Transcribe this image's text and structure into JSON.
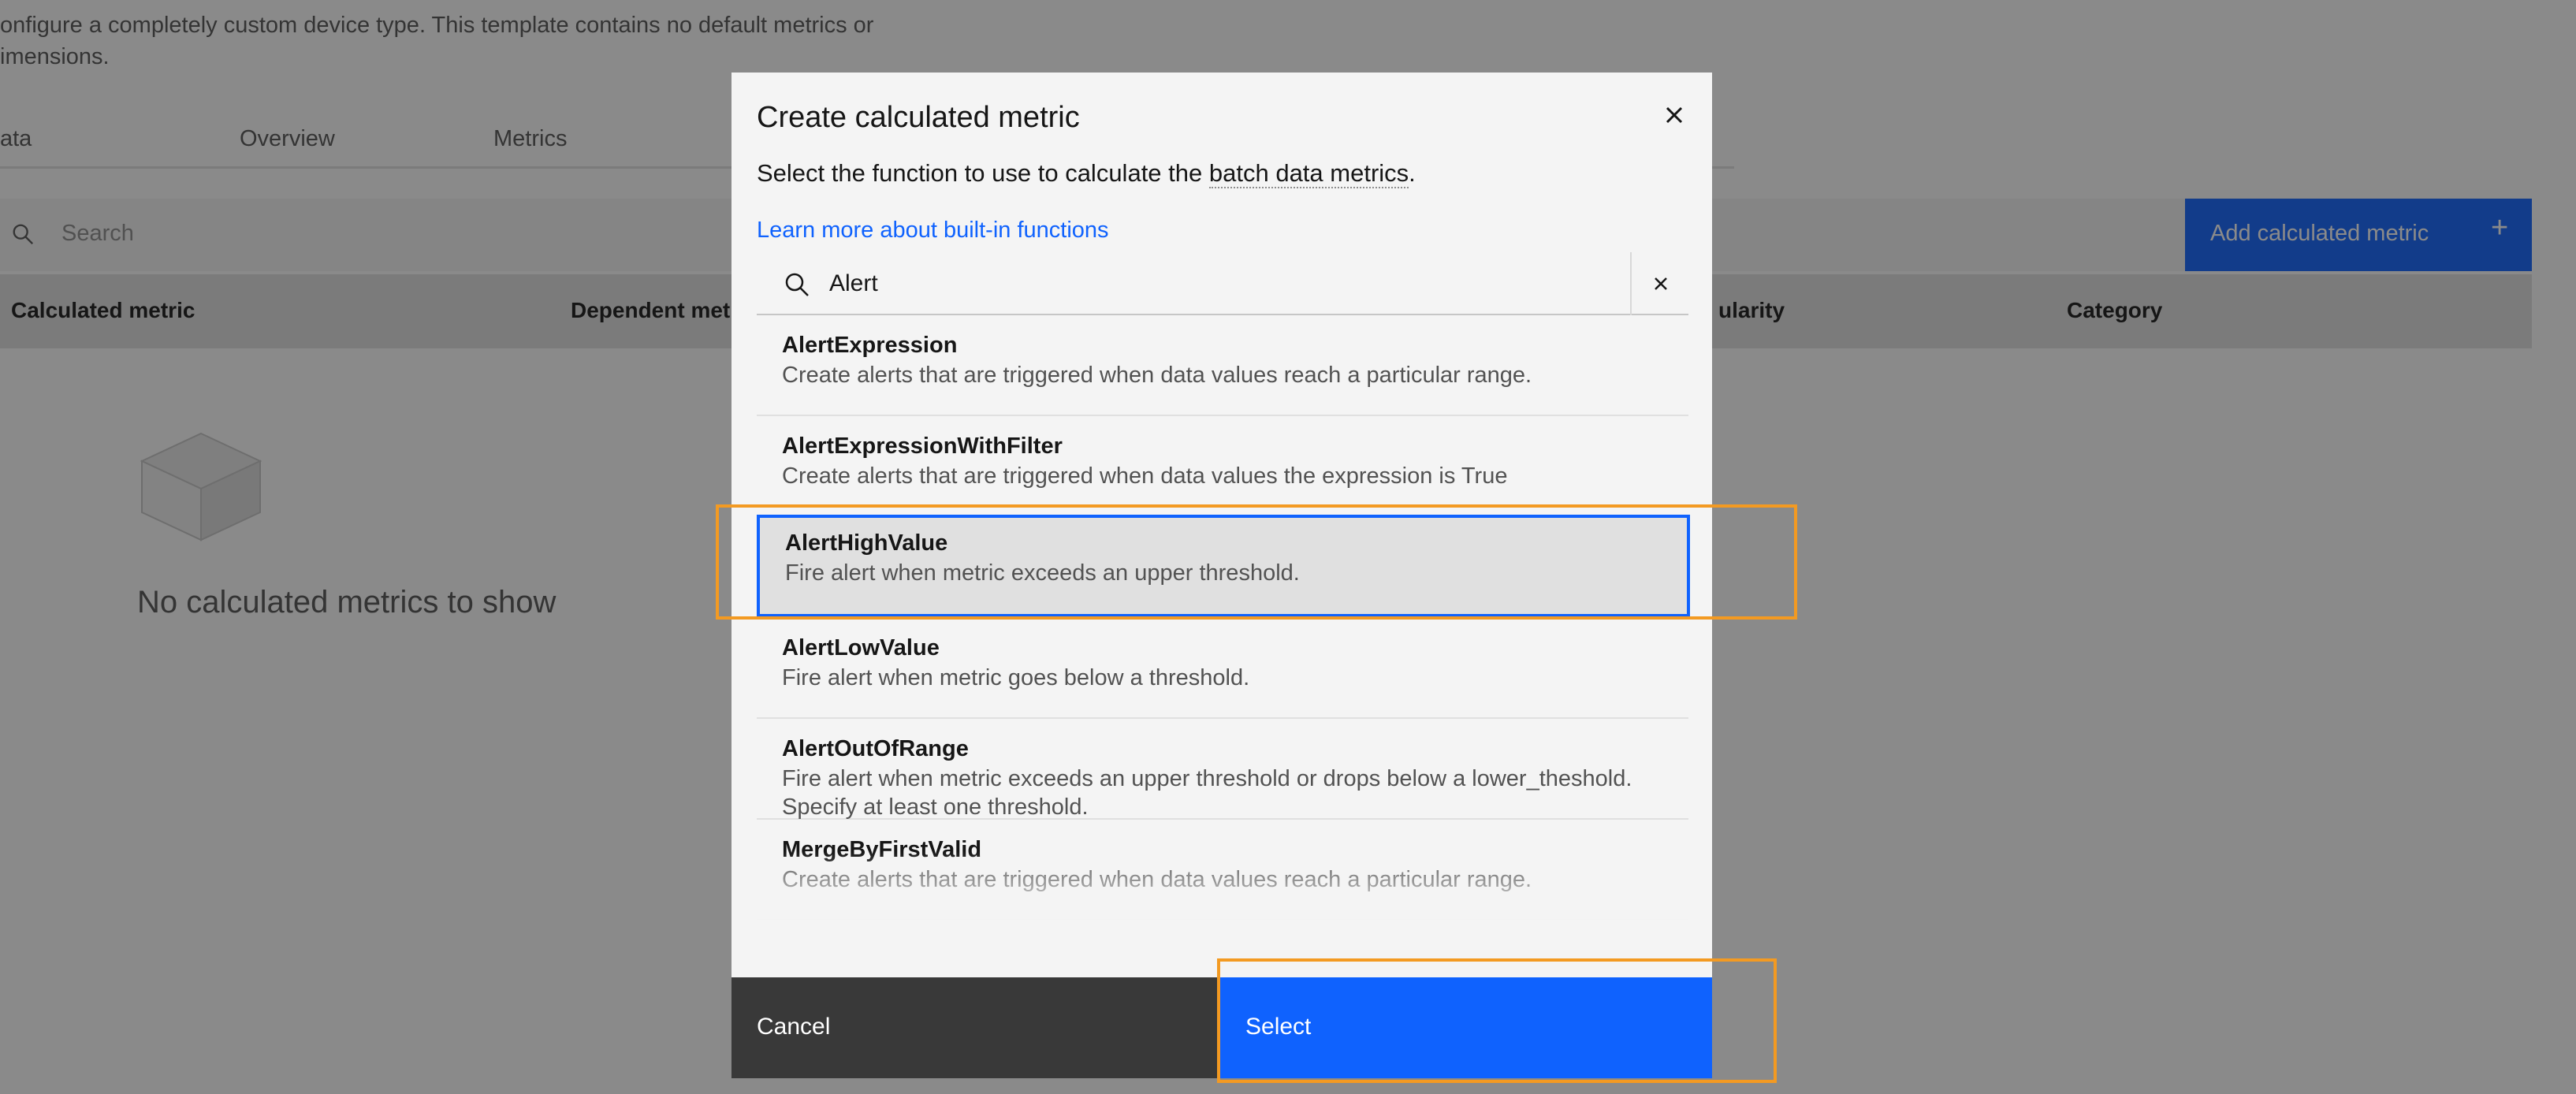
{
  "background": {
    "description": "onfigure a completely custom device type. This template contains no default metrics or\nimensions.",
    "tabs": [
      "ata",
      "Overview",
      "Metrics"
    ],
    "search_placeholder": "Search",
    "add_button_label": "Add calculated metric",
    "add_button_icon": "plus-icon",
    "table_headers": [
      "Calculated metric",
      "Dependent met",
      "ularity",
      "Category"
    ],
    "empty_state_text": "No calculated metrics to show",
    "empty_state_icon": "empty-box-icon"
  },
  "modal": {
    "title": "Create calculated metric",
    "subtitle_prefix": "Select the function to use to calculate the ",
    "subtitle_term": "batch data metrics",
    "subtitle_suffix": ".",
    "learn_more_link": "Learn more about built-in functions",
    "close_icon": "close-icon",
    "search": {
      "value": "Alert",
      "icon": "search-icon",
      "clear_icon": "close-icon"
    },
    "items": [
      {
        "name": "AlertExpression",
        "description": "Create alerts that are triggered when data values reach a particular range."
      },
      {
        "name": "AlertExpressionWithFilter",
        "description": "Create alerts that are triggered when data values the expression is True"
      },
      {
        "name": "AlertHighValue",
        "description": "Fire alert when metric exceeds an upper threshold.",
        "selected": true
      },
      {
        "name": "AlertLowValue",
        "description": "Fire alert when metric goes below a threshold."
      },
      {
        "name": "AlertOutOfRange",
        "description": "Fire alert when metric exceeds an upper threshold or drops below a lower_theshold. Specify at least one threshold."
      },
      {
        "name": "MergeByFirstValid",
        "description": "Create alerts that are triggered when data values reach a particular range."
      }
    ],
    "cancel_label": "Cancel",
    "select_label": "Select"
  },
  "colors": {
    "primary": "#0f62fe",
    "overlay": "rgba(22,22,22,0.5)",
    "annotation": "#f39a22",
    "secondary_button": "#393939"
  }
}
